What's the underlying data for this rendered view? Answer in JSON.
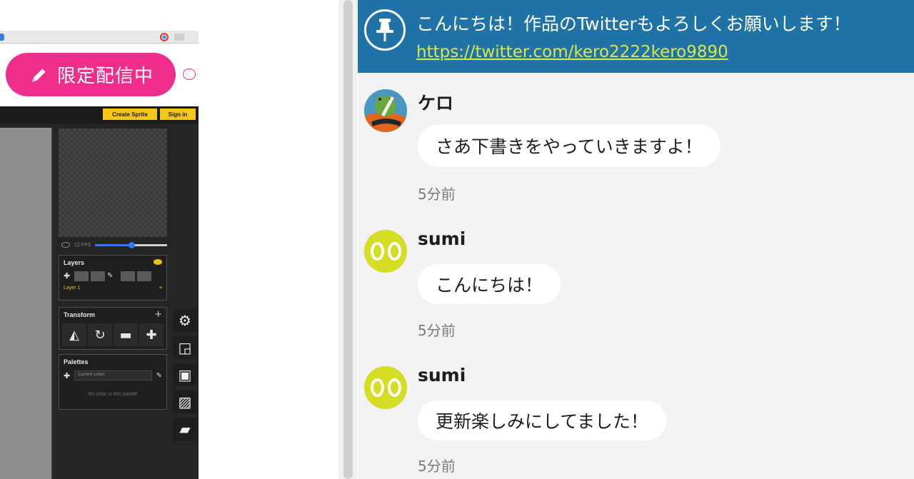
{
  "live_badge": {
    "label": "限定配信中",
    "color": "#ef2d8c",
    "icon": "pencil-icon"
  },
  "editor": {
    "create_sprite_label": "Create Sprite",
    "sign_in_label": "Sign in",
    "fps_label": "12 FPS",
    "fps_slider_level": 0.5,
    "layers": {
      "title": "Layers",
      "layer_name": "Layer 1",
      "layer_mark": "≡"
    },
    "transform": {
      "title": "Transform",
      "tools": [
        "flip-icon",
        "rotate-icon",
        "sheep-icon",
        "move-icon"
      ]
    },
    "palettes": {
      "title": "Palettes",
      "selected": "Current colors",
      "empty_text": "No color in this palette"
    },
    "side_tools": [
      "gear-icon",
      "resize-icon",
      "save-icon",
      "image-icon",
      "folder-icon"
    ],
    "accent_color": "#f5c518"
  },
  "chat": {
    "pinned": {
      "text": "こんにちは！作品のTwitterもよろしくお願いします！",
      "link": "https://twitter.com/kero2222kero9890",
      "background": "#1f73a6",
      "icon": "pin-icon"
    },
    "messages": [
      {
        "name": "ケロ",
        "text": "さあ下書きをやっていきますよ！",
        "time": "5分前",
        "avatar": "frog-avatar"
      },
      {
        "name": "sumi",
        "text": "こんにちは！",
        "time": "5分前",
        "avatar": "sumi-avatar"
      },
      {
        "name": "sumi",
        "text": "更新楽しみにしてました！",
        "time": "5分前",
        "avatar": "sumi-avatar"
      }
    ]
  }
}
